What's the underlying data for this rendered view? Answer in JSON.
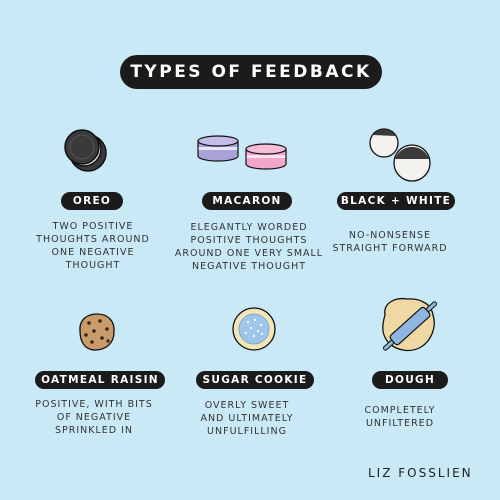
{
  "title": "TYPES OF FEEDBACK",
  "items": [
    {
      "label": "OREO",
      "desc": [
        "TWO POSITIVE",
        "THOUGHTS AROUND",
        "ONE NEGATIVE",
        "THOUGHT"
      ],
      "icon": "oreo-icon"
    },
    {
      "label": "MACARON",
      "desc": [
        "ELEGANTLY WORDED",
        "POSITIVE THOUGHTS",
        "AROUND ONE VERY SMALL",
        "NEGATIVE THOUGHT"
      ],
      "icon": "macaron-icon"
    },
    {
      "label": "BLACK + WHITE",
      "desc": [
        "NO-NONSENSE",
        "STRAIGHT FORWARD"
      ],
      "icon": "black-and-white-cookie-icon"
    },
    {
      "label": "OATMEAL RAISIN",
      "desc": [
        "POSITIVE, WITH BITS",
        "OF NEGATIVE",
        "SPRINKLED IN"
      ],
      "icon": "oatmeal-raisin-cookie-icon"
    },
    {
      "label": "SUGAR COOKIE",
      "desc": [
        "OVERLY SWEET",
        "AND ULTIMATELY",
        "UNFULFILLING"
      ],
      "icon": "sugar-cookie-icon"
    },
    {
      "label": "DOUGH",
      "desc": [
        "COMPLETELY",
        "UNFILTERED"
      ],
      "icon": "dough-with-rolling-pin-icon"
    }
  ],
  "signature": "LIZ FOSSLIEN"
}
